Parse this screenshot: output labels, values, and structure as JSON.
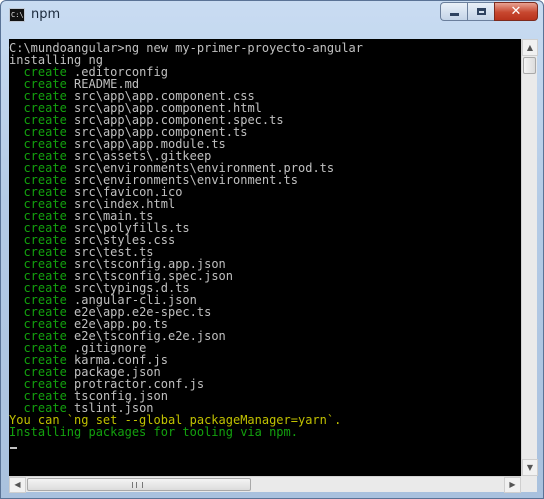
{
  "window": {
    "title": "npm",
    "icon": "cmd-icon",
    "icon_text": "C:\\",
    "buttons": {
      "minimize": "minimize-icon",
      "maximize": "maximize-icon",
      "close_label": "✕"
    }
  },
  "console": {
    "prompt_line": "C:\\mundoangular>ng new my-primer-proyecto-angular",
    "installing_line": "installing ng",
    "create_keyword": "create",
    "created_files": [
      ".editorconfig",
      "README.md",
      "src\\app\\app.component.css",
      "src\\app\\app.component.html",
      "src\\app\\app.component.spec.ts",
      "src\\app\\app.component.ts",
      "src\\app\\app.module.ts",
      "src\\assets\\.gitkeep",
      "src\\environments\\environment.prod.ts",
      "src\\environments\\environment.ts",
      "src\\favicon.ico",
      "src\\index.html",
      "src\\main.ts",
      "src\\polyfills.ts",
      "src\\styles.css",
      "src\\test.ts",
      "src\\tsconfig.app.json",
      "src\\tsconfig.spec.json",
      "src\\typings.d.ts",
      ".angular-cli.json",
      "e2e\\app.e2e-spec.ts",
      "e2e\\app.po.ts",
      "e2e\\tsconfig.e2e.json",
      ".gitignore",
      "karma.conf.js",
      "package.json",
      "protractor.conf.js",
      "tsconfig.json",
      "tslint.json"
    ],
    "hint_line": "You can `ng set --global packageManager=yarn`.",
    "status_line": "Installing packages for tooling via npm.",
    "colors": {
      "create": "#13a10e",
      "hint": "#c1c100",
      "status": "#13a10e",
      "text": "#c0c0c0",
      "background": "#000000"
    }
  }
}
